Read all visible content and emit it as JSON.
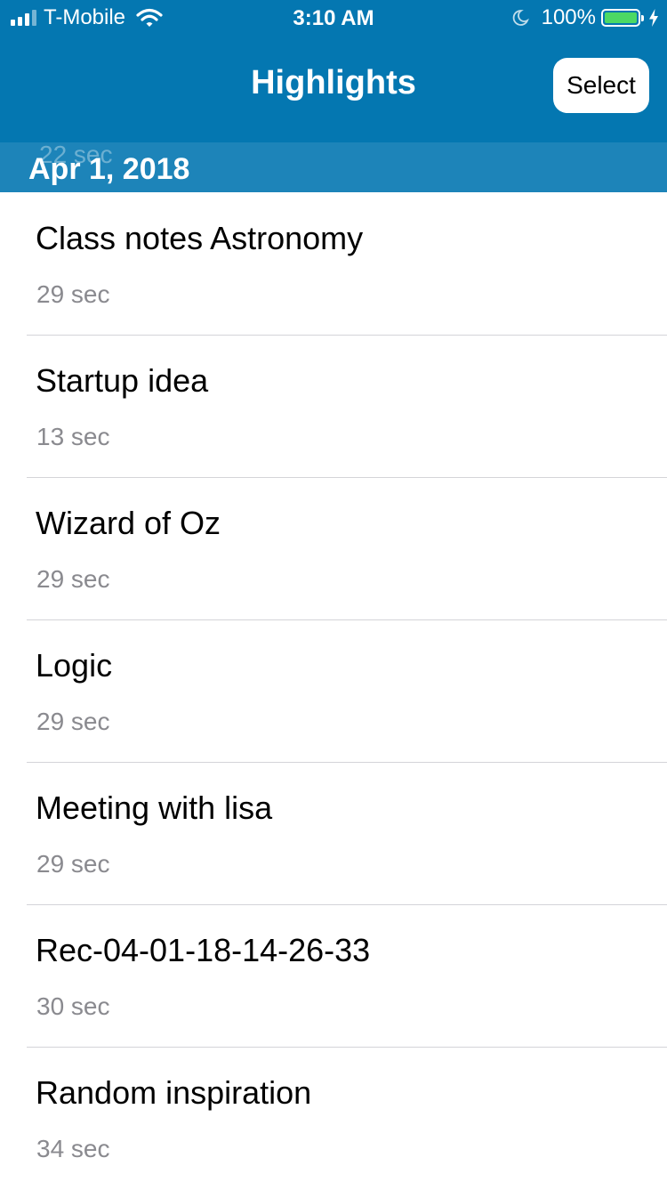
{
  "status_bar": {
    "carrier": "T-Mobile",
    "time": "3:10 AM",
    "battery_percent": "100%",
    "signal_bars_filled": 3,
    "signal_bars_total": 4,
    "icons": [
      "signal-icon",
      "wifi-icon",
      "moon-icon",
      "battery-icon",
      "charging-bolt-icon"
    ],
    "battery_color": "#4cd964"
  },
  "nav": {
    "title": "Highlights",
    "select_label": "Select",
    "background_color": "#0477b1"
  },
  "section": {
    "title": "Apr 1, 2018",
    "ghost_text": "22 sec"
  },
  "items": [
    {
      "title": "Class notes Astronomy",
      "duration": "29 sec"
    },
    {
      "title": "Startup idea",
      "duration": "13 sec"
    },
    {
      "title": "Wizard of Oz",
      "duration": "29 sec"
    },
    {
      "title": "Logic",
      "duration": "29 sec"
    },
    {
      "title": "Meeting with lisa",
      "duration": "29 sec"
    },
    {
      "title": "Rec-04-01-18-14-26-33",
      "duration": "30 sec"
    },
    {
      "title": "Random inspiration",
      "duration": "34 sec"
    }
  ]
}
